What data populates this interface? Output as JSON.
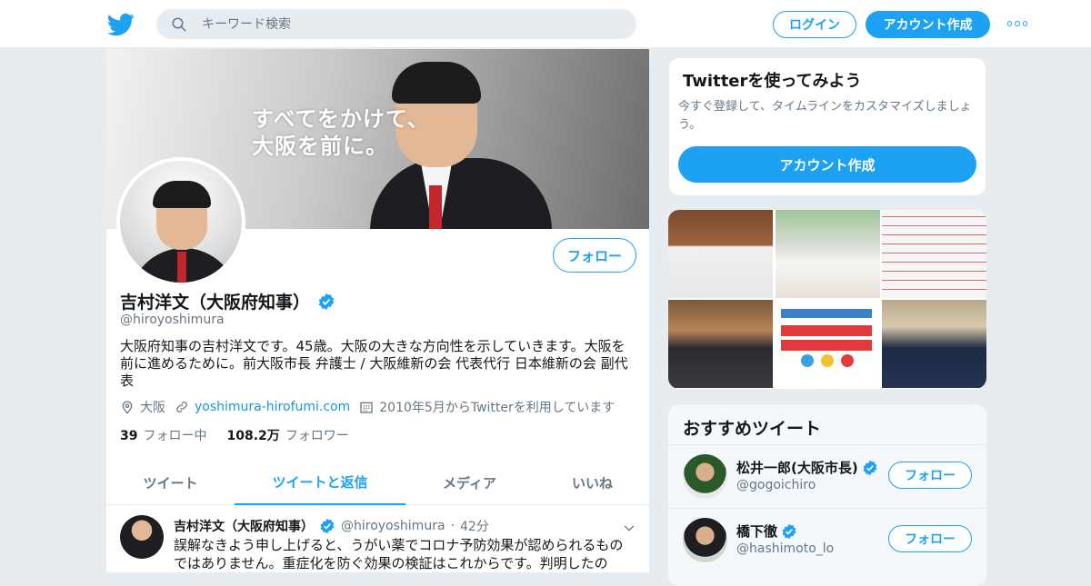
{
  "header": {
    "search_placeholder": "キーワード検索",
    "login_label": "ログイン",
    "signup_label": "アカウント作成"
  },
  "banner": {
    "line1": "すべてをかけて、",
    "line2": "大阪を前に。"
  },
  "profile": {
    "follow_label": "フォロー",
    "name": "吉村洋文（大阪府知事）",
    "handle": "@hiroyoshimura",
    "bio": "大阪府知事の吉村洋文です。45歳。大阪の大きな方向性を示していきます。大阪を前に進めるために。前大阪市長 弁護士 / 大阪維新の会 代表代行 日本維新の会 副代表",
    "location": "大阪",
    "website": "yoshimura-hirofumi.com",
    "joined": "2010年5月からTwitterを利用しています",
    "following_count": "39",
    "following_label": "フォロー中",
    "followers_count": "108.2万",
    "followers_label": "フォロワー"
  },
  "tabs": [
    "ツイート",
    "ツイートと返信",
    "メディア",
    "いいね"
  ],
  "tweet": {
    "name": "吉村洋文（大阪府知事）",
    "handle": "@hiroyoshimura",
    "sep": "·",
    "time": "42分",
    "text": "誤解なきよう申し上げると、うがい薬でコロナ予防効果が認められるものではありません。重症化を防ぐ効果の検証はこれからです。判明したの"
  },
  "signup_card": {
    "title": "Twitterを使ってみよう",
    "desc": "今すぐ登録して、タイムラインをカスタマイズしましょう。",
    "button": "アカウント作成"
  },
  "recommend": {
    "title": "おすすめツイート",
    "items": [
      {
        "name": "松井一郎(大阪市長)",
        "handle": "@gogoichiro",
        "button": "フォロー"
      },
      {
        "name": "橋下徹",
        "handle": "@hashimoto_lo",
        "button": "フォロー"
      }
    ]
  },
  "colors": {
    "accent": "#1da1f2",
    "text": "#14171a",
    "muted": "#657786",
    "background": "#e6ecf0"
  },
  "icons": [
    "twitter-bird-icon",
    "search-icon",
    "more-dots-icon",
    "verified-badge-icon",
    "location-icon",
    "link-icon",
    "calendar-icon",
    "chevron-down-icon"
  ]
}
